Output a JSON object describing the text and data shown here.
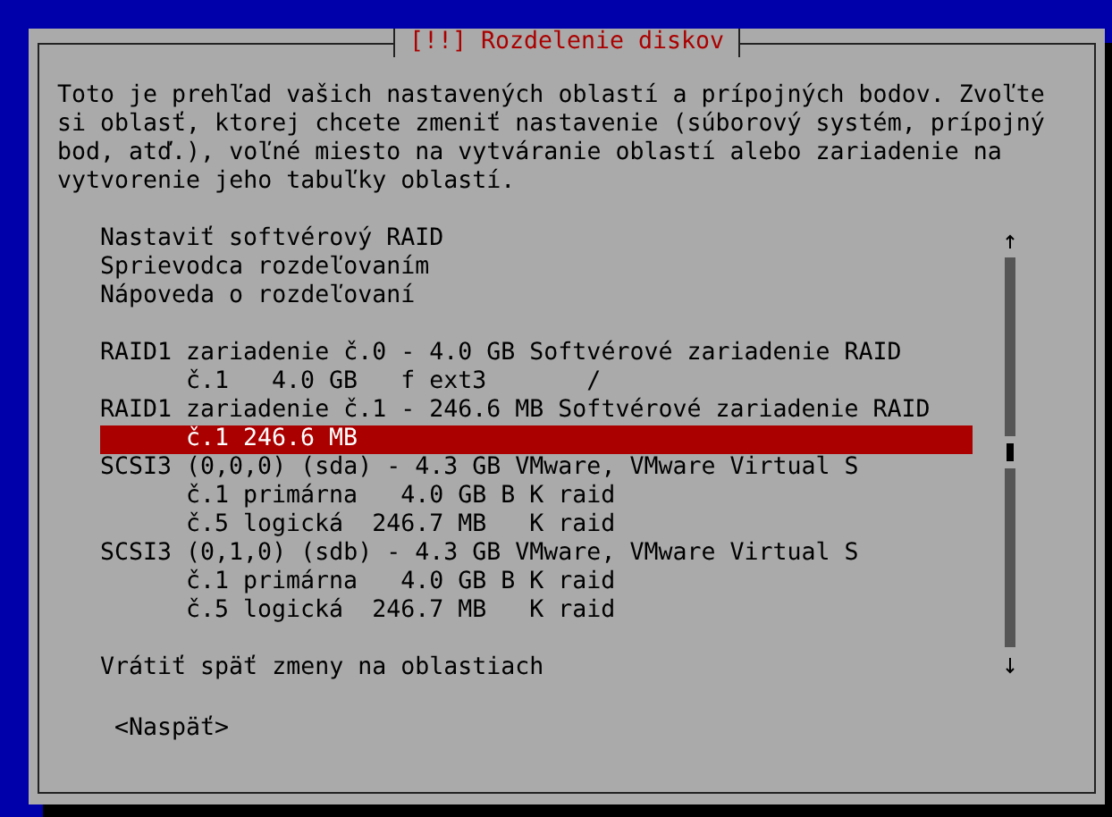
{
  "window": {
    "title": "[!!] Rozdelenie diskov"
  },
  "description": "Toto je prehľad vašich nastavených oblastí a prípojných bodov. Zvoľte si oblasť, ktorej chcete zmeniť nastavenie (súborový systém, prípojný bod, atď.), voľné miesto na vytváranie oblastí alebo zariadenie na vytvorenie jeho tabuľky oblastí.",
  "sections": [
    {
      "items": [
        {
          "label": "Nastaviť softvérový RAID",
          "selected": false
        },
        {
          "label": "Sprievodca rozdeľovaním",
          "selected": false
        },
        {
          "label": "Nápoveda o rozdeľovaní",
          "selected": false
        }
      ]
    },
    {
      "items": [
        {
          "label": "RAID1 zariadenie č.0 - 4.0 GB Softvérové zariadenie RAID",
          "selected": false,
          "children": [
            {
              "label": "č.1   4.0 GB   f ext3       /",
              "selected": false
            }
          ]
        },
        {
          "label": "RAID1 zariadenie č.1 - 246.6 MB Softvérové zariadenie RAID",
          "selected": false,
          "children": [
            {
              "label": "č.1 246.6 MB",
              "selected": true
            }
          ]
        },
        {
          "label": "SCSI3 (0,0,0) (sda) - 4.3 GB VMware, VMware Virtual S",
          "selected": false,
          "children": [
            {
              "label": "č.1 primárna   4.0 GB B K raid",
              "selected": false
            },
            {
              "label": "č.5 logická  246.7 MB   K raid",
              "selected": false
            }
          ]
        },
        {
          "label": "SCSI3 (0,1,0) (sdb) - 4.3 GB VMware, VMware Virtual S",
          "selected": false,
          "children": [
            {
              "label": "č.1 primárna   4.0 GB B K raid",
              "selected": false
            },
            {
              "label": "č.5 logická  246.7 MB   K raid",
              "selected": false
            }
          ]
        }
      ]
    },
    {
      "items": [
        {
          "label": "Vrátiť späť zmeny na oblastiach",
          "selected": false
        }
      ]
    }
  ],
  "buttons": [
    {
      "label": "<Naspäť>",
      "selected": false
    }
  ]
}
